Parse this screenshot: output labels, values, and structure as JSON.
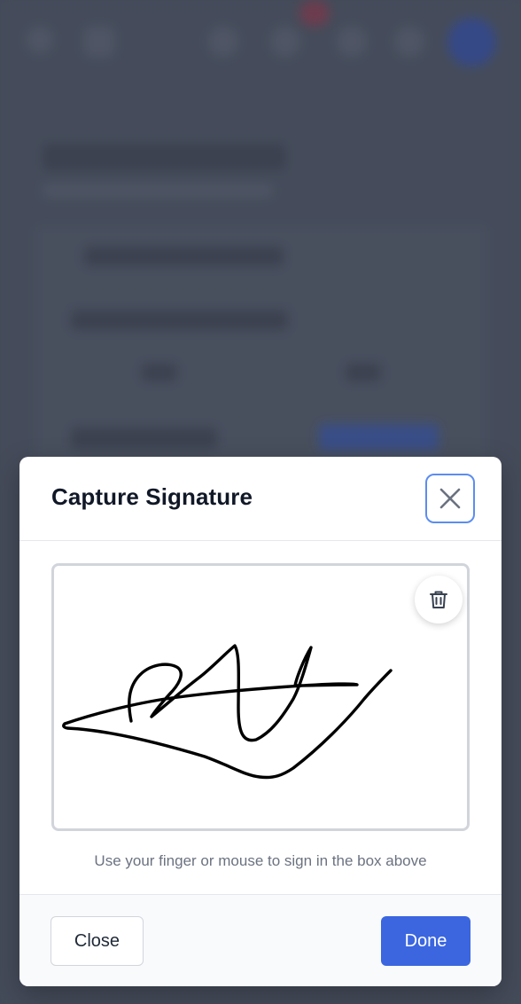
{
  "modal": {
    "title": "Capture Signature",
    "close_icon": "close-icon",
    "clear_icon": "trash-icon",
    "helper_text": "Use your finger or mouse to sign in the box above",
    "close_button_label": "Close",
    "done_button_label": "Done"
  },
  "colors": {
    "primary": "#3b66e0",
    "focus_ring": "#5b8def",
    "backdrop": "#4b5261"
  }
}
